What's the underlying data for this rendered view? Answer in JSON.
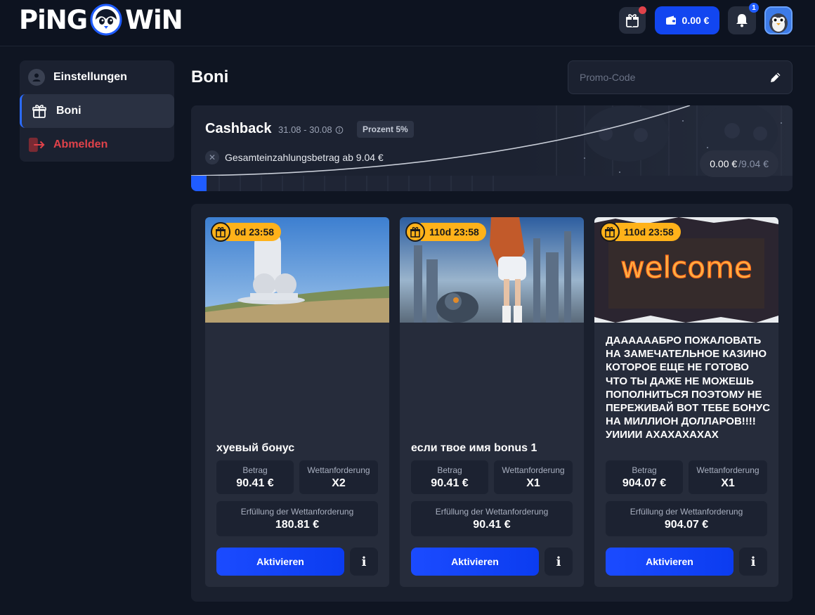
{
  "header": {
    "logo_left": "PiNG",
    "logo_right": "WiN",
    "balance": "0.00 €",
    "notification_count": "1"
  },
  "sidebar": {
    "items": [
      {
        "label": "Einstellungen",
        "icon": "user-icon"
      },
      {
        "label": "Boni",
        "icon": "gift-icon",
        "active": true
      },
      {
        "label": "Abmelden",
        "icon": "logout-icon"
      }
    ]
  },
  "page": {
    "title": "Boni",
    "promo_placeholder": "Promo-Code"
  },
  "cashback": {
    "title": "Cashback",
    "dates": "31.08 - 30.08",
    "tag": "Prozent 5%",
    "requirement": "Gesamteinzahlungsbetrag ab 9.04 €",
    "current": "0.00 €",
    "total": "/9.04 €"
  },
  "bonuses": [
    {
      "timer": "0d 23:58",
      "name": "хуевый бонус",
      "description": "",
      "amount_label": "Betrag",
      "amount": "90.41 €",
      "wager_label": "Wettanforderung",
      "wager": "X2",
      "fulfil_label": "Erfüllung der Wettanforderung",
      "fulfil": "180.81 €",
      "activate_label": "Aktivieren",
      "info_label": "i"
    },
    {
      "timer": "110d 23:58",
      "name": "если твое имя bonus 1",
      "description": "",
      "amount_label": "Betrag",
      "amount": "90.41 €",
      "wager_label": "Wettanforderung",
      "wager": "X1",
      "fulfil_label": "Erfüllung der Wettanforderung",
      "fulfil": "90.41 €",
      "activate_label": "Aktivieren",
      "info_label": "i"
    },
    {
      "timer": "110d 23:58",
      "name": "",
      "image_text": "welcome",
      "description": "ДААААААБРО ПОЖАЛОВАТЬ НА ЗАМЕЧАТЕЛЬНОЕ КАЗИНО КОТОРОЕ ЕЩЕ НЕ ГОТОВО ЧТО ТЫ ДАЖЕ НЕ МОЖЕШЬ ПОПОЛНИТЬСЯ ПОЭТОМУ НЕ ПЕРЕЖИВАЙ ВОТ ТЕБЕ БОНУС НА МИЛЛИОН ДОЛЛАРОВ!!!! УИИИИ АХАХАХАХАХ",
      "amount_label": "Betrag",
      "amount": "904.07 €",
      "wager_label": "Wettanforderung",
      "wager": "X1",
      "fulfil_label": "Erfüllung der Wettanforderung",
      "fulfil": "904.07 €",
      "activate_label": "Aktivieren",
      "info_label": "i"
    }
  ],
  "colors": {
    "accent": "#1246f0",
    "timer": "#ffb21a",
    "logout": "#e0424a",
    "background": "#0f1522"
  }
}
